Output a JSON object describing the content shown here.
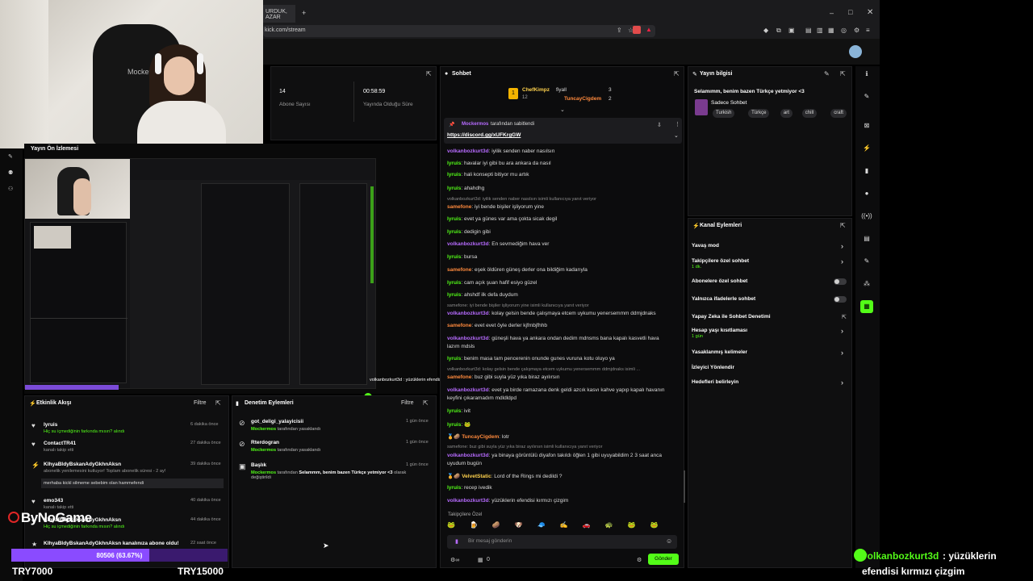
{
  "browser": {
    "tab_title": "URDUK, AZAR",
    "url": "kick.com/stream"
  },
  "stats": {
    "followers_value": "14",
    "followers_label": "Abone Sayısı",
    "uptime_value": "00:58:59",
    "uptime_label": "Yayında Olduğu Süre"
  },
  "preview": {
    "title": "Yayın Ön İzlemesi"
  },
  "overlay": {
    "brand": "ByNoGame",
    "goal_text": "80506 (63.67%)",
    "goal_fraction": 0.6367,
    "goal_left": "TRY7000",
    "goal_right": "TRY15000",
    "notice": "volkanbozkurt3d : yüzüklerin efendisi kırmızı çizgim",
    "notice_user": "volkanbozkurt3d",
    "notice_text": " : yüzüklerin",
    "notice_text2": "efendisi kırmızı çizgim"
  },
  "activity": {
    "title": "Etkinlik Akışı",
    "filter": "Filtre",
    "items": [
      {
        "user": "lyruis",
        "sub": "Hiç su içmediğinin farkında mısın?",
        "sub2": " alındı",
        "time": "6 dakika önce"
      },
      {
        "user": "ContactTR41",
        "sub": "kanalı takip etti",
        "sub2": "",
        "time": "27 dakika önce"
      },
      {
        "user": "KlhyaBldyBskanAdyGkhnAksn",
        "sub": "abonelik yenilemesini kutluyor! Toplam abonelik süresi - 2 ay!",
        "sub2": "",
        "time": "39 dakika önce"
      },
      {
        "user": "emo343",
        "sub": "kanalı takip etti",
        "sub2": "",
        "time": "40 dakika önce"
      },
      {
        "user": "KlhyaBldyBskanAdyGkhnAksn",
        "sub": "Hiç su içmediğinin farkında mısın?",
        "sub2": " alındı",
        "time": "44 dakika önce"
      },
      {
        "user": "KlhyaBldyBskanAdyGkhnAksn kanalınıza abone oldu!",
        "sub": "",
        "sub2": "",
        "time": "22 saat önce"
      }
    ],
    "quote": "merhaba kickl silmeme sebebim olan hammefendi"
  },
  "moderation": {
    "title": "Denetim Eylemleri",
    "filter": "Filtre",
    "items": [
      {
        "user": "got_deligi_yalayicisii",
        "by": "Mockermos",
        "desc": " tarafından yasaklandı",
        "time": "1 gün önce"
      },
      {
        "user": "Rterdogran",
        "by": "Mockermos",
        "desc": " tarafından yasaklandı",
        "time": "1 gün önce"
      },
      {
        "user": "Başlık",
        "by": "Mockermos",
        "desc": " tarafından ",
        "desc2": "Selammm, benim bazen Türkçe yetmiyor <3",
        "desc3": " olarak değiştirildi",
        "time": "1 gün önce"
      }
    ]
  },
  "chat": {
    "title": "Sohbet",
    "top": [
      {
        "rank": "1",
        "name": "ChefKimpz",
        "sub": "12"
      },
      {
        "rank": "",
        "name": "fiyall",
        "sub": "3"
      },
      {
        "rank": "",
        "name": "TuncayCigdem",
        "sub": "2"
      }
    ],
    "pinned_by": "Mockermos",
    "pinned_text": "tarafından sabitlendi",
    "pinned_link": "https://discord.gg/xUFKrgGW",
    "messages": [
      {
        "u": "volkanbozkurt3d",
        "c": "p",
        "m": ": iyilik senden naber nasılsın"
      },
      {
        "u": "lyruis",
        "c": "g",
        "m": ": havalar iyi gibi bu ara ankara da nasıl"
      },
      {
        "u": "lyruis",
        "c": "g",
        "m": ": hali konsepti bitiyor mu artık"
      },
      {
        "u": "lyruis",
        "c": "g",
        "m": ": ahahdhg"
      },
      {
        "sys": "volkanbozkurt3d: iyilik senden naber nasılsın isimli kullanıcıya yanıt veriyor"
      },
      {
        "u": "samefone",
        "c": "o",
        "m": ": iyi bende bişiler işliyorum yine"
      },
      {
        "u": "lyruis",
        "c": "g",
        "m": ": evet ya günes var ama çokta sicak degil"
      },
      {
        "u": "lyruis",
        "c": "g",
        "m": ": dedigin gibi"
      },
      {
        "u": "volkanbozkurt3d",
        "c": "p",
        "m": ": En sevmediğim hava ver"
      },
      {
        "u": "lyruis",
        "c": "g",
        "m": ": bursa"
      },
      {
        "u": "samefone",
        "c": "o",
        "m": ": eşek öldüren güneş derler ona bildiğim kadarıyla"
      },
      {
        "u": "lyruis",
        "c": "g",
        "m": ": cam açık şuan hafif esiyo güzel"
      },
      {
        "u": "lyruis",
        "c": "g",
        "m": ": ahshdf ilk defa duydum"
      },
      {
        "sys": "samefone: iyi bende bişiler işliyorum yine isimli kullanıcıya yanıt veriyor"
      },
      {
        "u": "volkanbozkurt3d",
        "c": "p",
        "m": ": kolay gelsin bende çalışmaya etcem uykumu yenersemmm ddmjdnaks"
      },
      {
        "u": "samefone",
        "c": "o",
        "m": ": evet evet öyle derler kjfmbjfhhb"
      },
      {
        "u": "volkanbozkurt3d",
        "c": "p",
        "m": ": güneşli hava ya ankara ondan dedim mdnsms bana kapalı kasvetli hava"
      },
      {
        "cont": "lazım mdsls"
      },
      {
        "u": "lyruis",
        "c": "g",
        "m": ": benim masa tam pencerenin onunde gunes vuruna kotu oluyo ya"
      },
      {
        "sys": "volkanbozkurt3d: kolay gelsin bende çalışmaya etcem uykumu yenersemmm ddmjdnaks isimli ..."
      },
      {
        "u": "samefone",
        "c": "o",
        "m": ": buz gibi suyla yüz yıka biraz ayılırsın"
      },
      {
        "u": "volkanbozkurt3d",
        "c": "p",
        "m": ": evet ya birde ramazana denk geldi azcık kasvı kahve yapıp kapalı havanın"
      },
      {
        "cont": "keyfini çıkaramadım mdldldpd"
      },
      {
        "u": "lyruis",
        "c": "g",
        "m": ": ivit"
      },
      {
        "u": "lyruis",
        "c": "g",
        "m": ": 🐸"
      },
      {
        "u": "TuncayCigdem",
        "c": "o",
        "m": ": lotr",
        "badges": true
      },
      {
        "sys": "samefone: buz gibi suyla yüz yıka biraz ayılırsın isimli kullanıcıya yanıt veriyor"
      },
      {
        "u": "volkanbozkurt3d",
        "c": "p",
        "m": ": ya binaya görüntülü diyafon takıldı öğlen 1 gibi uyuyabildim 2 3 saat anca"
      },
      {
        "cont": "uyudum bugün"
      },
      {
        "u": "VelvetStatic",
        "c": "y",
        "m": ": Lord of the Rings mi dedildi ?",
        "badges": true
      },
      {
        "u": "lyruis",
        "c": "g",
        "m": ": recep ivedik"
      },
      {
        "u": "volkanbozkurt3d",
        "c": "p",
        "m": ": yüzüklerin efendisi kırmızı çizgim"
      }
    ],
    "followers_only": "Takipçilere Özel",
    "input_placeholder": "Bir mesaj gönderin",
    "send": "Gönder",
    "counter": "0"
  },
  "stream_info": {
    "title": "Yayın bilgisi",
    "stream_title": "Selamımm, benim bazen Türkçe yetmiyor <3",
    "category": "Sadece Sohbet",
    "tags": [
      "Turkish",
      "Türkçe",
      "art",
      "chill",
      "craft",
      "game"
    ]
  },
  "channel_actions": {
    "title": "Kanal Eylemleri",
    "items": [
      {
        "label": "Yavaş mod",
        "sub": "",
        "ctl": "arrow"
      },
      {
        "label": "Takipçilere özel sohbet",
        "sub": "1 dk.",
        "ctl": "arrow"
      },
      {
        "label": "Abonelere özel sohbet",
        "sub": "",
        "ctl": "toggle"
      },
      {
        "label": "Yalnızca ifadelerle sohbet",
        "sub": "",
        "ctl": "toggle"
      },
      {
        "label": "Yapay Zeka ile Sohbet Denetimi",
        "sub": "",
        "ctl": "ext"
      },
      {
        "label": "Hesap yaşı kısıtlaması",
        "sub": "1 gün",
        "ctl": "arrow"
      },
      {
        "label": "Yasaklanmış kelimeler",
        "sub": "",
        "ctl": "arrow"
      },
      {
        "label": "İzleyici Yönlendir",
        "sub": "",
        "ctl": ""
      },
      {
        "label": "Hedefleri belirleyin",
        "sub": "",
        "ctl": "arrow"
      }
    ]
  },
  "webcam_label": "Mockerm"
}
